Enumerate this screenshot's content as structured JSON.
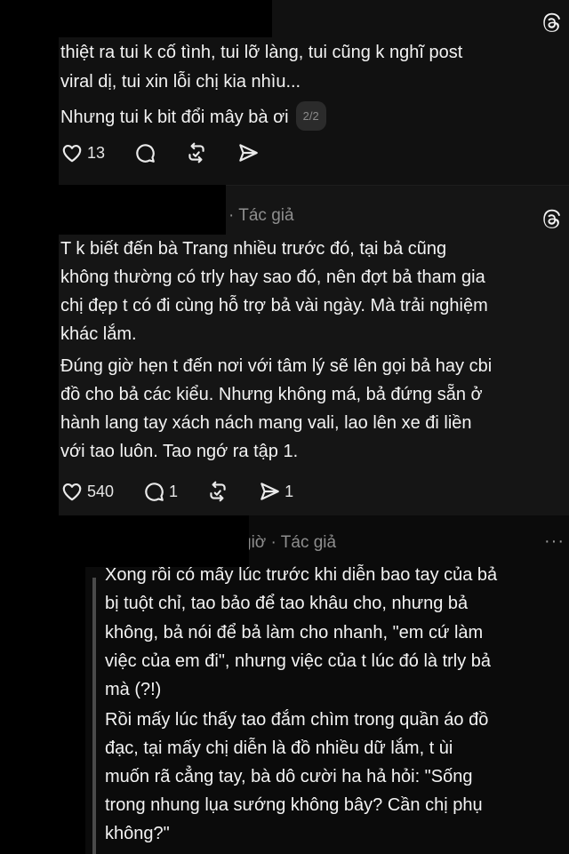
{
  "post1": {
    "lines": [
      "thiệt ra tui k cố tình, tui lỡ làng, tui cũng k nghĩ post",
      "viral dị, tui xin lỗi chị kia nhìu..."
    ],
    "last_line": "Nhưng tui k bit đổi mây bà ơi",
    "page_indicator": "2/2",
    "likes": "13"
  },
  "post2": {
    "meta": "· Tác giả",
    "para1": [
      "T k biết đến bà Trang nhiều trước đó, tại bả cũng",
      "không thường có trly hay sao đó, nên đợt bả tham gia",
      "chị đẹp t có đi cùng hỗ trợ bả vài ngày. Mà trải nghiệm",
      "khác lắm."
    ],
    "para2": [
      "Đúng giờ hẹn t đến nơi với tâm lý sẽ lên gọi bả hay cbi",
      "đồ cho bả các kiểu. Nhưng không má, bả đứng sẵn ở",
      "hành lang tay xách nách mang vali, lao lên xe đi liền",
      "với tao luôn. Tao ngớ ra tập 1."
    ],
    "likes": "540",
    "replies": "1",
    "shares": "1"
  },
  "post3": {
    "meta": "giờ · Tác giả",
    "more": "···",
    "para1": [
      "Xong rồi có mấy lúc trước khi diễn bao tay của bả",
      "bị tuột chỉ, tao bảo để tao khâu cho, nhưng bả",
      "không, bả nói để bả làm cho nhanh, \"em cứ làm",
      "việc của em đi\", nhưng việc của t lúc đó là trly bả",
      "mà (?!)"
    ],
    "para2": [
      "Rồi mấy lúc thấy tao đắm chìm trong quần áo đồ",
      "đạc, tại mấy chị diễn là đồ nhiều dữ lắm, t ùi",
      "muốn rã cẳng tay, bà dô cười ha hả hỏi: \"Sống",
      "trong nhung lụa sướng không bây? Cần chị phụ",
      "không?\""
    ]
  },
  "icons": [
    "threads-logo-icon",
    "heart-icon",
    "comment-icon",
    "repost-icon",
    "share-icon",
    "more-icon"
  ]
}
